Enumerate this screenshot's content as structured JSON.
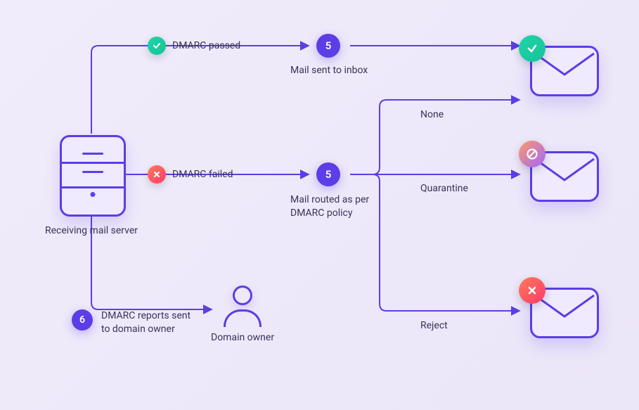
{
  "server_label": "Receiving mail server",
  "passed_label": "DMARC passed",
  "failed_label": "DMARC failed",
  "inbox_num": "5",
  "inbox_label": "Mail sent to inbox",
  "routed_num": "5",
  "routed_label_l1": "Mail routed as per",
  "routed_label_l2": "DMARC policy",
  "policy_none": "None",
  "policy_quarantine": "Quarantine",
  "policy_reject": "Reject",
  "reports_num": "6",
  "reports_label_l1": "DMARC reports sent",
  "reports_label_l2": "to domain owner",
  "owner_label": "Domain owner"
}
